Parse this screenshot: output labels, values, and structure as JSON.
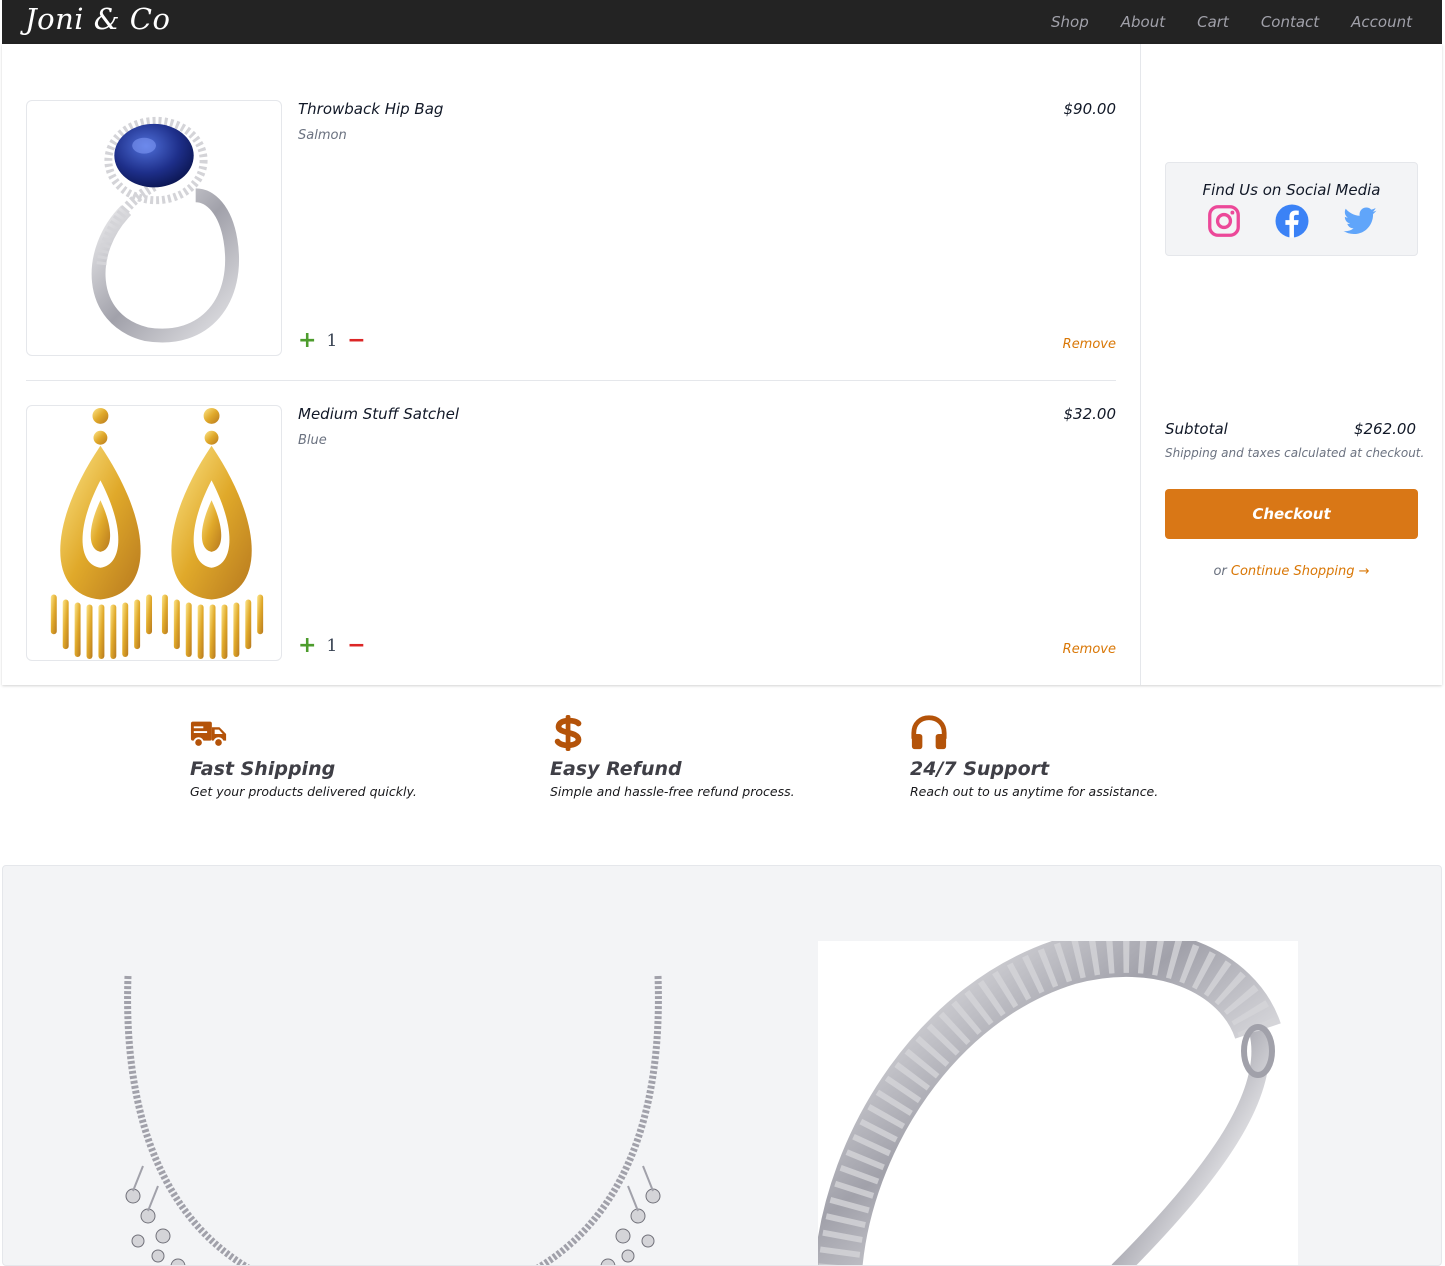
{
  "brand": "Joni & Co",
  "nav": [
    "Shop",
    "About",
    "Cart",
    "Contact",
    "Account"
  ],
  "cart": {
    "items": [
      {
        "name": "Throwback Hip Bag",
        "variant": "Salmon",
        "price": "$90.00",
        "qty": "1",
        "remove": "Remove",
        "image": "sapphire-ring-image"
      },
      {
        "name": "Medium Stuff Satchel",
        "variant": "Blue",
        "price": "$32.00",
        "qty": "1",
        "remove": "Remove",
        "image": "gold-earrings-image"
      }
    ]
  },
  "qty_icons": {
    "plus": "+",
    "minus": "−"
  },
  "social": {
    "title": "Find Us on Social Media",
    "icons": [
      "instagram-icon",
      "facebook-icon",
      "twitter-icon"
    ],
    "colors": {
      "instagram": "#ec4899",
      "facebook": "#3b82f6",
      "twitter": "#60a5fa"
    }
  },
  "summary": {
    "subtotal_label": "Subtotal",
    "subtotal_value": "$262.00",
    "shipping_note": "Shipping and taxes calculated at checkout.",
    "checkout": "Checkout",
    "or": "or",
    "continue": "Continue Shopping →"
  },
  "features": [
    {
      "icon": "truck-icon",
      "title": "Fast Shipping",
      "desc": "Get your products delivered quickly."
    },
    {
      "icon": "dollar-icon",
      "title": "Easy Refund",
      "desc": "Simple and hassle-free refund process."
    },
    {
      "icon": "headphones-icon",
      "title": "24/7 Support",
      "desc": "Reach out to us anytime for assistance."
    }
  ],
  "colors": {
    "accent": "#d97716",
    "feature_icon": "#b45309",
    "navbar": "#232323",
    "plus": "#4d9c2d",
    "minus": "#dc2626"
  },
  "gallery": [
    "diamond-necklace-image",
    "silver-bangle-image"
  ]
}
